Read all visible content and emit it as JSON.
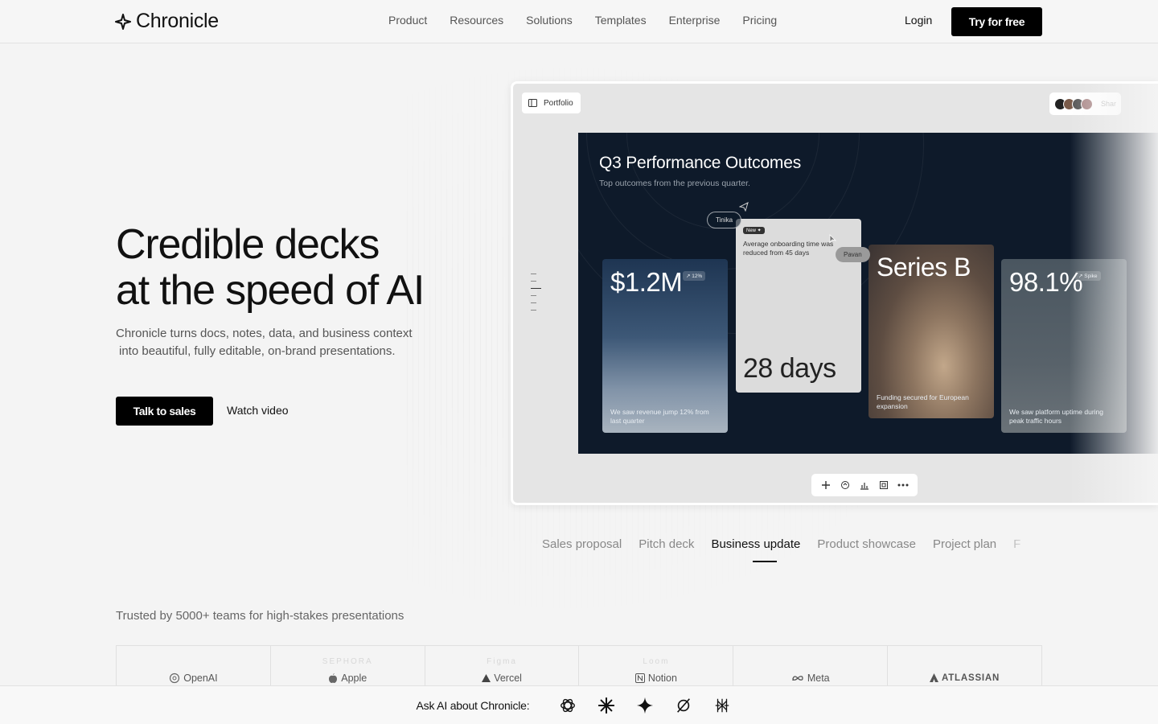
{
  "nav": {
    "brand": "Chronicle",
    "links": [
      "Product",
      "Resources",
      "Solutions",
      "Templates",
      "Enterprise",
      "Pricing"
    ],
    "login": "Login",
    "cta": "Try for free"
  },
  "hero": {
    "title_line1": "Credible decks",
    "title_line2": "at the speed of AI",
    "subtitle_line1": "Chronicle turns docs, notes, data, and business context",
    "subtitle_line2": "into beautiful, fully editable, on-brand presentations.",
    "primary_cta": "Talk to sales",
    "secondary_cta": "Watch video"
  },
  "app": {
    "sidebar_toggle_label": "Portfolio",
    "share_label": "Shar",
    "slide": {
      "title": "Q3 Performance Outcomes",
      "subtitle": "Top outcomes from the previous quarter.",
      "cards": [
        {
          "value": "$1.2M",
          "badge": "↗ 12%",
          "desc": "We saw revenue jump 12% from last quarter"
        },
        {
          "tag": "New ✦",
          "desc": "Average onboarding time was reduced from 45 days",
          "value": "28 days"
        },
        {
          "value": "Series B",
          "desc": "Funding secured for European expansion"
        },
        {
          "value": "98.1%",
          "badge": "↗ Spike",
          "desc": "We saw platform uptime during peak traffic hours"
        }
      ],
      "cursors": [
        "Tinika",
        "Pavan"
      ]
    },
    "toolbar_icons": [
      "plus-icon",
      "refresh-icon",
      "chart-icon",
      "frame-icon",
      "more-icon"
    ]
  },
  "tabs": {
    "items": [
      "Sales proposal",
      "Pitch deck",
      "Business update",
      "Product showcase",
      "Project plan",
      "F"
    ],
    "active": "Business update"
  },
  "trusted": {
    "label": "Trusted by 5000+ teams for high-stakes presentations",
    "logos": [
      {
        "name": "OpenAI",
        "ghost": ""
      },
      {
        "name": "Apple",
        "ghost": "SEPHORA"
      },
      {
        "name": "Vercel",
        "ghost": "Figma"
      },
      {
        "name": "Notion",
        "ghost": "Loom"
      },
      {
        "name": "Meta",
        "ghost": ""
      },
      {
        "name": "ATLASSIAN",
        "ghost": ""
      }
    ]
  },
  "ask_ai": {
    "label": "Ask AI about Chronicle:",
    "icons": [
      "chatgpt-icon",
      "claude-icon",
      "gemini-icon",
      "perplexity-icon",
      "grok-icon"
    ]
  }
}
